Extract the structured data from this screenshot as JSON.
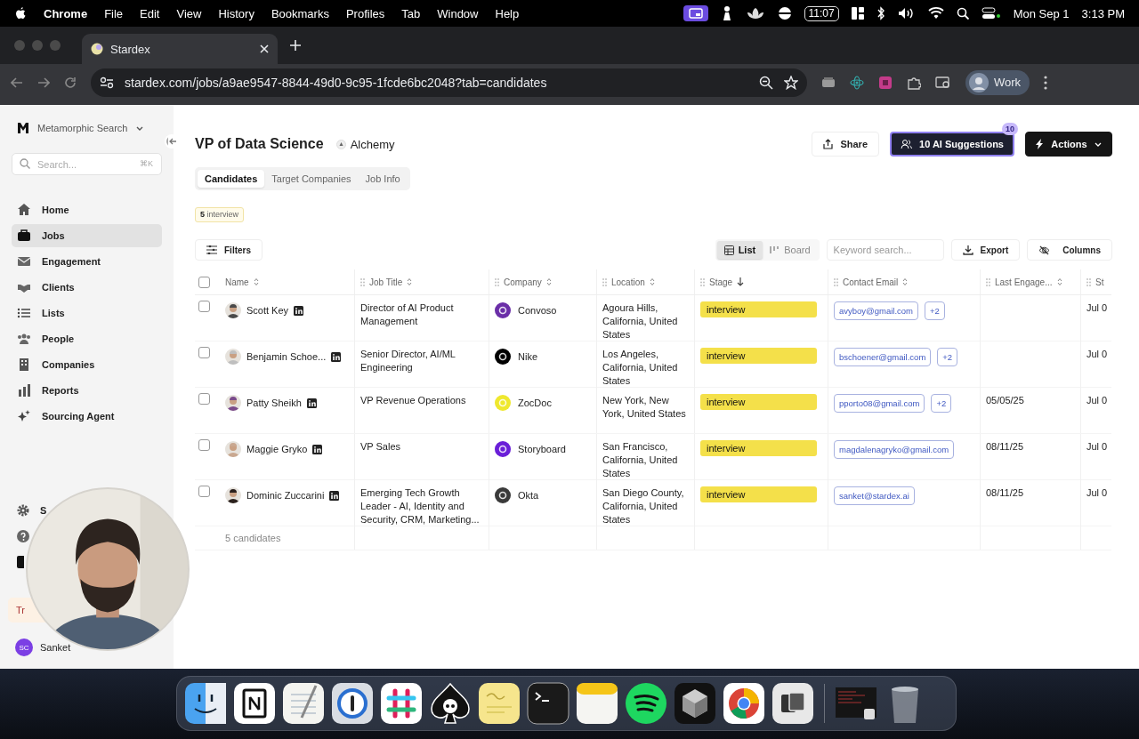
{
  "menubar": {
    "app": "Chrome",
    "menus": [
      "File",
      "Edit",
      "View",
      "History",
      "Bookmarks",
      "Profiles",
      "Tab",
      "Window",
      "Help"
    ],
    "clock_widget": "11:07",
    "date": "Mon Sep 1",
    "time": "3:13 PM"
  },
  "browser": {
    "tab_title": "Stardex",
    "url": "stardex.com/jobs/a9ae9547-8844-49d0-9c95-1fcde6bc2048?tab=candidates",
    "profile": "Work"
  },
  "sidebar": {
    "workspace": "Metamorphic Search",
    "search": {
      "placeholder": "Search...",
      "shortcut": "⌘K"
    },
    "items": [
      {
        "label": "Home",
        "selected": false
      },
      {
        "label": "Jobs",
        "selected": true
      },
      {
        "label": "Engagement",
        "selected": false
      },
      {
        "label": "Clients",
        "selected": false
      },
      {
        "label": "Lists",
        "selected": false
      },
      {
        "label": "People",
        "selected": false
      },
      {
        "label": "Companies",
        "selected": false
      },
      {
        "label": "Reports",
        "selected": false
      },
      {
        "label": "Sourcing Agent",
        "selected": false
      }
    ],
    "settings_label": "S",
    "trial_banner": "Tr",
    "user": {
      "initials": "SC",
      "name": "Sanket"
    }
  },
  "job": {
    "title": "VP of Data Science",
    "client": "Alchemy",
    "share": "Share",
    "ai_suggestions": "10 AI Suggestions",
    "ai_badge": "10",
    "actions": "Actions",
    "tabs": [
      {
        "label": "Candidates",
        "selected": true
      },
      {
        "label": "Target Companies",
        "selected": false
      },
      {
        "label": "Job Info",
        "selected": false
      }
    ],
    "stage_filter": "**5** interview",
    "filters": "Filters",
    "views": [
      {
        "label": "List",
        "selected": true
      },
      {
        "label": "Board",
        "selected": false
      }
    ],
    "keyword_search": {
      "placeholder": "Keyword search..."
    },
    "export": "Export",
    "columns_button": "Columns"
  },
  "table": {
    "header_checked": false,
    "columns": [
      {
        "label": "Name",
        "sorted": false
      },
      {
        "label": "Job Title",
        "sorted": false
      },
      {
        "label": "Company",
        "sorted": false
      },
      {
        "label": "Location",
        "sorted": false
      },
      {
        "label": "Stage",
        "sorted": true
      },
      {
        "label": "Contact Email",
        "sorted": false
      },
      {
        "label": "Last Engage...",
        "sorted": false
      },
      {
        "label": "St"
      }
    ],
    "rows": [
      {
        "checked": false,
        "name": "Scott Key",
        "job_title": "Director of AI Product Management",
        "company": {
          "name": "Convoso",
          "color": "#6b2fa8"
        },
        "location": "Agoura Hills, California, United States",
        "stage": "interview",
        "email": "avyboy@gmail.com",
        "more_emails": "+2",
        "started": "Jul 0"
      },
      {
        "checked": false,
        "name": "Benjamin Schoe...",
        "job_title": "Senior Director, AI/ML Engineering",
        "company": {
          "name": "Nike",
          "color": "#000000"
        },
        "location": "Los Angeles, California, United States",
        "stage": "interview",
        "email": "bschoener@gmail.com",
        "more_emails": "+2",
        "started": "Jul 0"
      },
      {
        "checked": false,
        "name": "Patty Sheikh",
        "job_title": "VP Revenue Operations",
        "company": {
          "name": "ZocDoc",
          "color": "#efe82e"
        },
        "location": "New York, New York, United States",
        "stage": "interview",
        "email": "pporto08@gmail.com",
        "more_emails": "+2",
        "last_engaged": "05/05/25",
        "started": "Jul 0"
      },
      {
        "checked": false,
        "name": "Maggie Gryko",
        "job_title": "VP Sales",
        "company": {
          "name": "Storyboard",
          "color": "#6a1fd8"
        },
        "location": "San Francisco, California, United States",
        "stage": "interview",
        "email": "magdalenagryko@gmail.com",
        "last_engaged": "08/11/25",
        "started": "Jul 0"
      },
      {
        "checked": false,
        "name": "Dominic Zuccarini",
        "job_title": "Emerging Tech Growth Leader - AI, Identity and Security, CRM, Marketing...",
        "company": {
          "name": "Okta",
          "color": "#3a3a3a"
        },
        "location": "San Diego County, California, United States",
        "stage": "interview",
        "email": "sanket@stardex.ai",
        "last_engaged": "08/11/25",
        "started": "Jul 0"
      }
    ],
    "footer": "5 candidates"
  }
}
